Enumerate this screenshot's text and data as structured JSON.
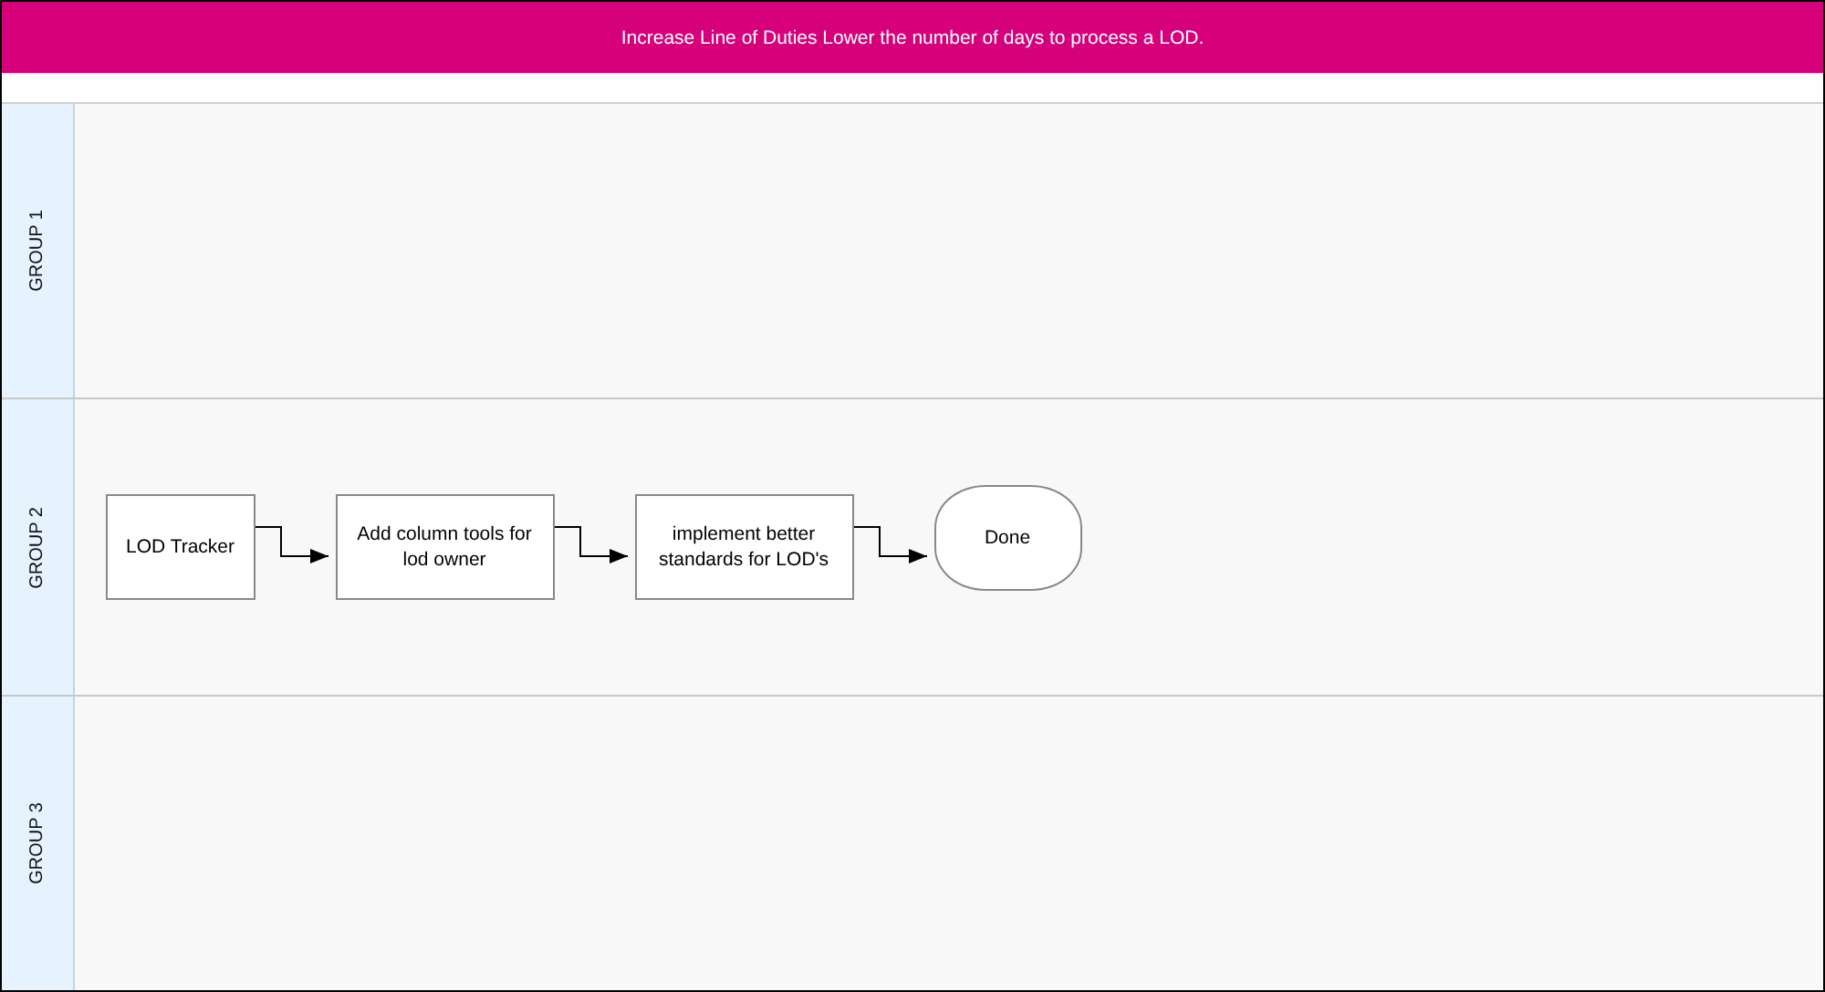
{
  "banner": {
    "title": "Increase Line of Duties Lower the number of days to process a LOD."
  },
  "lanes": [
    {
      "label": "GROUP 1"
    },
    {
      "label": "GROUP 2",
      "nodes": [
        {
          "text": "LOD Tracker",
          "kind": "process"
        },
        {
          "text": "Add column tools for lod owner",
          "kind": "process"
        },
        {
          "text": "implement better standards for LOD's",
          "kind": "process"
        },
        {
          "text": "Done",
          "kind": "terminal"
        }
      ]
    },
    {
      "label": "GROUP 3"
    }
  ]
}
